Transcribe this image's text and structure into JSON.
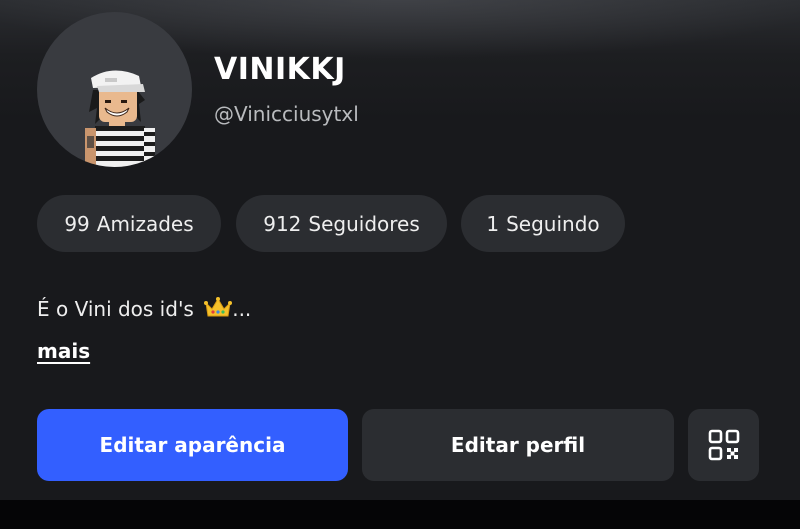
{
  "profile": {
    "display_name": "VINIKKJ",
    "username": "@Vinicciusytxl"
  },
  "stats": [
    {
      "count": "99",
      "label": "Amizades"
    },
    {
      "count": "912",
      "label": "Seguidores"
    },
    {
      "count": "1",
      "label": "Seguindo"
    }
  ],
  "bio": {
    "text": "É o Vini dos id's",
    "ellipsis": "...",
    "more_label": "mais"
  },
  "actions": {
    "edit_appearance_label": "Editar aparência",
    "edit_profile_label": "Editar perfil",
    "qr_icon": "qr-code-icon"
  },
  "colors": {
    "primary_button": "#335fff",
    "surface": "#2b2d31",
    "background": "#18191c"
  }
}
